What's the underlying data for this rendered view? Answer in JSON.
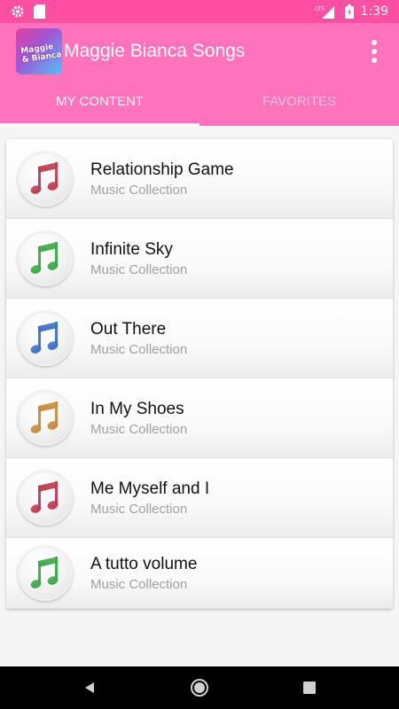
{
  "status_bar": {
    "network": "LTE",
    "time": "1:39",
    "icons": [
      "gear-icon",
      "sd-card-icon",
      "signal-icon",
      "battery-icon"
    ]
  },
  "app_bar": {
    "title": "Maggie Bianca Songs",
    "logo_text": "Maggie & Bianca"
  },
  "tabs": [
    {
      "label": "MY CONTENT",
      "active": true
    },
    {
      "label": "FAVORITES",
      "active": false
    }
  ],
  "songs": [
    {
      "title": "Relationship Game",
      "subtitle": "Music Collection",
      "note_color": "#c0394f"
    },
    {
      "title": "Infinite Sky",
      "subtitle": "Music Collection",
      "note_color": "#3aa846"
    },
    {
      "title": "Out There",
      "subtitle": "Music Collection",
      "note_color": "#3b6fc9"
    },
    {
      "title": "In My Shoes",
      "subtitle": "Music Collection",
      "note_color": "#c88a3a"
    },
    {
      "title": "Me Myself and I",
      "subtitle": "Music Collection",
      "note_color": "#c0394f"
    },
    {
      "title": "A tutto volume",
      "subtitle": "Music Collection",
      "note_color": "#3aa846"
    }
  ],
  "nav": [
    "back-icon",
    "home-icon",
    "recents-icon"
  ],
  "colors": {
    "primary": "#ff73bd",
    "status": "#ff4fa3"
  }
}
